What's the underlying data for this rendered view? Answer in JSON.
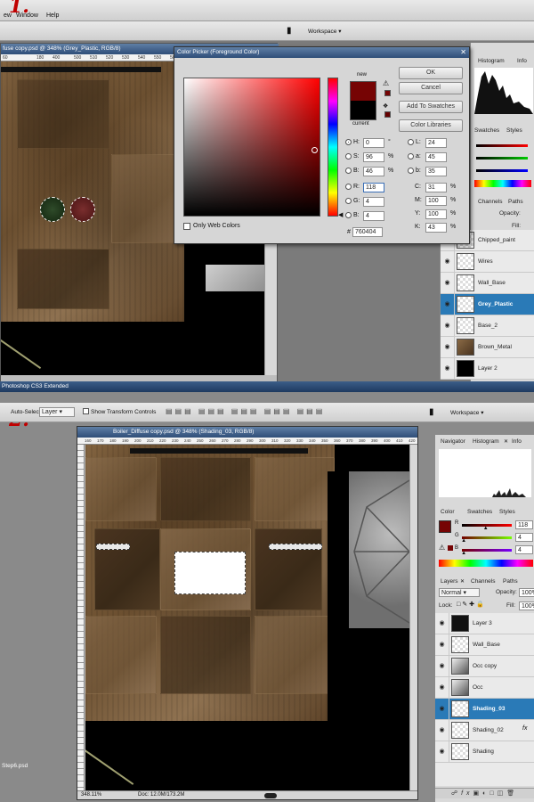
{
  "step1": {
    "step_number": "1.",
    "menu": [
      "ew",
      "Window",
      "Help"
    ],
    "workspace_label": "Workspace",
    "doc_title": "fuse copy.psd @ 348% (Grey_Plastic, RGB/8)",
    "ruler_marks": [
      "60",
      "180",
      "400",
      "500",
      "510",
      "520",
      "530",
      "540",
      "550",
      "560"
    ],
    "app_status": "Photoshop CS3 Extended",
    "color_picker": {
      "title": "Color Picker (Foreground Color)",
      "new_label": "new",
      "current_label": "current",
      "buttons": {
        "ok": "OK",
        "cancel": "Cancel",
        "add_swatches": "Add To Swatches",
        "color_libraries": "Color Libraries"
      },
      "only_web_colors": "Only Web Colors",
      "new_color": "#760404",
      "current_color": "#000000",
      "hsb": [
        {
          "label": "H:",
          "value": "0",
          "unit": "°"
        },
        {
          "label": "S:",
          "value": "96",
          "unit": "%"
        },
        {
          "label": "B:",
          "value": "46",
          "unit": "%"
        }
      ],
      "rgb": [
        {
          "label": "R:",
          "value": "118"
        },
        {
          "label": "G:",
          "value": "4"
        },
        {
          "label": "B:",
          "value": "4"
        }
      ],
      "lab": [
        {
          "label": "L:",
          "value": "24"
        },
        {
          "label": "a:",
          "value": "45"
        },
        {
          "label": "b:",
          "value": "35"
        }
      ],
      "cmyk": [
        {
          "label": "C:",
          "value": "31",
          "unit": "%"
        },
        {
          "label": "M:",
          "value": "100",
          "unit": "%"
        },
        {
          "label": "Y:",
          "value": "100",
          "unit": "%"
        },
        {
          "label": "K:",
          "value": "43",
          "unit": "%"
        }
      ],
      "hex_label": "#",
      "hex_value": "760404"
    },
    "panels": {
      "histogram_tab": "Histogram",
      "info_tab": "Info",
      "swatches_tab": "Swatches",
      "styles_tab": "Styles",
      "channels_tab": "Channels",
      "paths_tab": "Paths",
      "opacity_label": "Opacity:",
      "fill_label": "Fill:"
    },
    "layers": [
      {
        "name": "Chipped_paint",
        "selected": false
      },
      {
        "name": "Wires",
        "selected": false
      },
      {
        "name": "Wall_Base",
        "selected": false
      },
      {
        "name": "Grey_Plastic",
        "selected": true
      },
      {
        "name": "Base_2",
        "selected": false
      },
      {
        "name": "Brown_Metal",
        "selected": false
      },
      {
        "name": "Layer 2",
        "selected": false
      }
    ]
  },
  "step2": {
    "step_number": "2.",
    "options": {
      "auto_select": "Auto-Select:",
      "layer_select": "Layer",
      "show_transform": "Show Transform Controls"
    },
    "workspace_label": "Workspace",
    "doc_title": "Boiler_Diffuse copy.psd @ 348% (Shading_03, RGB/8)",
    "ruler_marks": [
      "160",
      "170",
      "180",
      "190",
      "200",
      "210",
      "220",
      "230",
      "240",
      "250",
      "260",
      "270",
      "280",
      "290",
      "300",
      "310",
      "320",
      "330",
      "340",
      "350",
      "360",
      "370",
      "380",
      "390",
      "400",
      "410",
      "420"
    ],
    "zoom": "348.11%",
    "doc_size": "Doc: 12.0M/173.2M",
    "taskbar_file": "Step6.psd",
    "panels": {
      "navigator_tab": "Navigator",
      "histogram_tab": "Histogram",
      "info_tab": "Info",
      "color_tab": "Color",
      "swatches_tab": "Swatches",
      "styles_tab": "Styles",
      "layers_tab": "Layers",
      "channels_tab": "Channels",
      "paths_tab": "Paths",
      "blend_mode": "Normal",
      "opacity_label": "Opacity:",
      "opacity_value": "100%",
      "lock_label": "Lock:",
      "fill_label": "Fill:",
      "fill_value": "100%"
    },
    "color_panel": {
      "foreground": "#760404",
      "sliders": [
        {
          "label": "R",
          "value": "118",
          "fraction": 0.46
        },
        {
          "label": "G",
          "value": "4",
          "fraction": 0.02
        },
        {
          "label": "B",
          "value": "4",
          "fraction": 0.02
        }
      ]
    },
    "layers": [
      {
        "name": "Layer 3",
        "selected": false
      },
      {
        "name": "Wall_Base",
        "selected": false
      },
      {
        "name": "Occ copy",
        "selected": false
      },
      {
        "name": "Occ",
        "selected": false
      },
      {
        "name": "Shading_03",
        "selected": true
      },
      {
        "name": "Shading_02",
        "selected": false
      },
      {
        "name": "Shading",
        "selected": false
      }
    ]
  }
}
